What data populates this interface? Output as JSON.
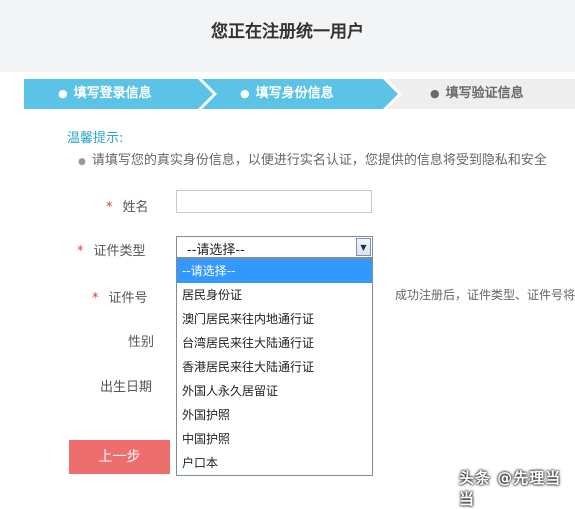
{
  "page": {
    "title": "您正在注册统一用户"
  },
  "steps": [
    {
      "label": "填写登录信息",
      "state": "done"
    },
    {
      "label": "填写身份信息",
      "state": "active"
    },
    {
      "label": "填写验证信息",
      "state": "pending"
    }
  ],
  "colors": {
    "step_active": "#5bc4e6",
    "step_pending": "#eeeeee",
    "required_mark": "#e23b3b",
    "tip_title": "#2fa6c7",
    "prev_button": "#ee6d6d",
    "option_highlight": "#3399ff"
  },
  "tips": {
    "title": "温馨提示:",
    "text": "请填写您的真实身份信息，以便进行实名认证，您提供的信息将受到隐私和安全"
  },
  "form": {
    "required_mark": "*",
    "name_label": "姓名",
    "id_type_label": "证件类型",
    "id_number_label": "证件号",
    "gender_label": "性别",
    "birth_label": "出生日期",
    "id_type_selected": "--请选择--",
    "id_type_options": [
      "--请选择--",
      "居民身份证",
      "澳门居民来往内地通行证",
      "台湾居民来往大陆通行证",
      "香港居民来往大陆通行证",
      "外国人永久居留证",
      "外国护照",
      "中国护照",
      "户口本"
    ],
    "id_number_note": "成功注册后，证件类型、证件号将"
  },
  "buttons": {
    "prev_label": "上一步"
  },
  "watermark": {
    "text": "头条 @先理当当"
  }
}
